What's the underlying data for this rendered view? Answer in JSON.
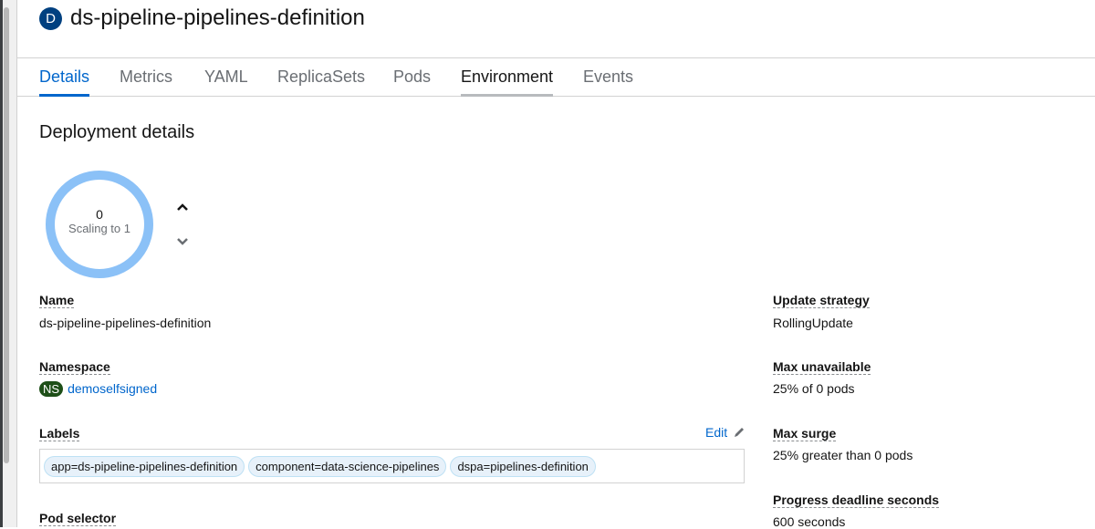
{
  "header": {
    "badge": "D",
    "title": "ds-pipeline-pipelines-definition"
  },
  "tabs": [
    {
      "label": "Details"
    },
    {
      "label": "Metrics"
    },
    {
      "label": "YAML"
    },
    {
      "label": "ReplicaSets"
    },
    {
      "label": "Pods"
    },
    {
      "label": "Environment"
    },
    {
      "label": "Events"
    }
  ],
  "section": {
    "title": "Deployment details"
  },
  "pod_ring": {
    "count": "0",
    "status": "Scaling to 1",
    "ring_color": "#8bc1f7"
  },
  "details": {
    "name_label": "Name",
    "name_value": "ds-pipeline-pipelines-definition",
    "namespace_label": "Namespace",
    "namespace_badge": "NS",
    "namespace_value": "demoselfsigned",
    "labels_label": "Labels",
    "edit_label": "Edit",
    "labels": [
      "app=ds-pipeline-pipelines-definition",
      "component=data-science-pipelines",
      "dspa=pipelines-definition"
    ],
    "pod_selector_label": "Pod selector"
  },
  "strategy": {
    "update_strategy_label": "Update strategy",
    "update_strategy_value": "RollingUpdate",
    "max_unavailable_label": "Max unavailable",
    "max_unavailable_value": "25% of 0 pods",
    "max_surge_label": "Max surge",
    "max_surge_value": "25% greater than 0 pods",
    "progress_deadline_label": "Progress deadline seconds",
    "progress_deadline_value": "600 seconds"
  },
  "colors": {
    "link": "#0066cc",
    "active_tab": "#0066cc",
    "ns_badge": "#1e4f18",
    "resource_badge": "#004080"
  }
}
